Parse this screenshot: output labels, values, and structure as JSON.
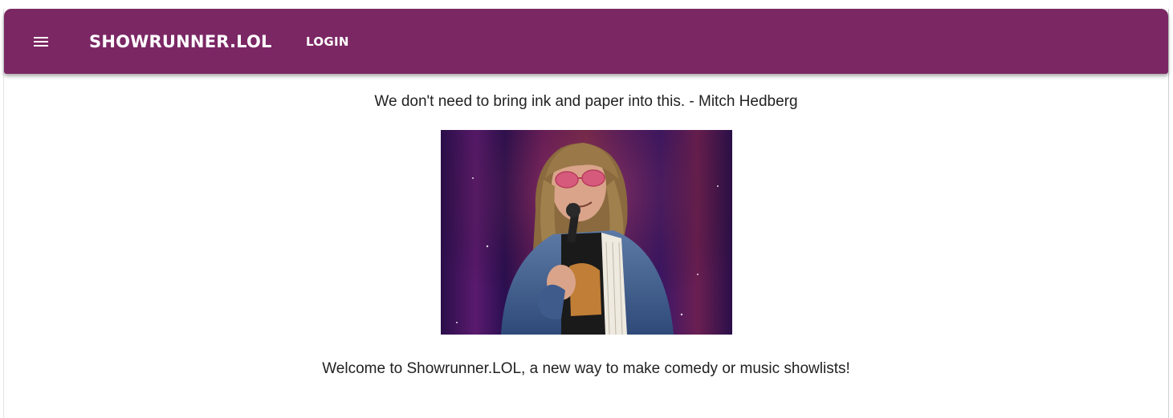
{
  "header": {
    "brand": "SHOWRUNNER.LOL",
    "login_label": "LOGIN",
    "menu_icon": "hamburger-menu-icon",
    "background_color": "#7b2764",
    "text_color": "#ffffff"
  },
  "main": {
    "quote": "We don't need to bring ink and paper into this. - Mitch Hedberg",
    "image": {
      "alt": "Comedian on stage holding microphone"
    },
    "welcome": "Welcome to Showrunner.LOL, a new way to make comedy or music showlists!"
  }
}
